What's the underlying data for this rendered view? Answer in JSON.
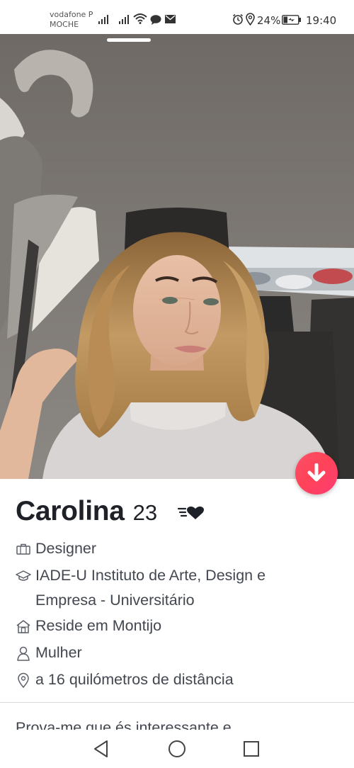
{
  "status_bar": {
    "carrier_line1": "vodafone P",
    "carrier_line2": "MOCHE",
    "battery": "24%",
    "time": "19:40",
    "icons": [
      "signal-icon",
      "signal-icon",
      "wifi-icon",
      "message-icon",
      "mail-icon",
      "alarm-icon",
      "location-icon",
      "battery-charging-icon"
    ]
  },
  "profile": {
    "name": "Carolina",
    "age": "23",
    "badge_icon": "heart-speed-icon",
    "job": "Designer",
    "school": "IADE-U Instituto de Arte, Design e Empresa - Universitário",
    "residence": "Reside em Montijo",
    "gender": "Mulher",
    "distance": "a 16 quilómetros de distância",
    "bio_preview": "Prova-me que és interessante e"
  },
  "actions": {
    "collapse_icon": "arrow-down-icon"
  },
  "navigation": {
    "icons": [
      "back-icon",
      "home-icon",
      "recent-apps-icon"
    ]
  },
  "colors": {
    "accent": "#fe3c72",
    "text": "#1f2128",
    "secondary": "#424750"
  }
}
